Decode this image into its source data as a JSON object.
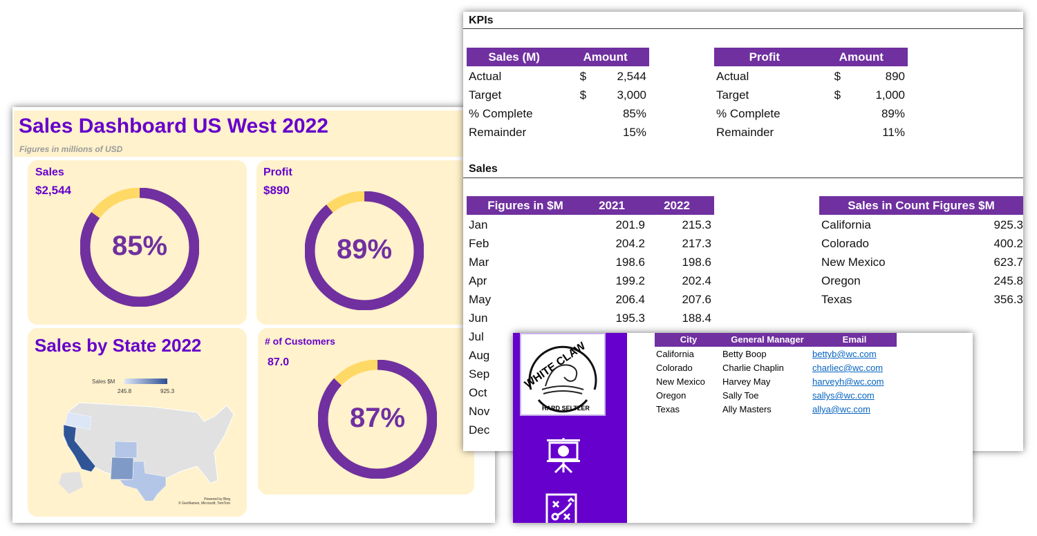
{
  "dashboard": {
    "title": "Sales Dashboard US West 2022",
    "subtitle": "Figures in millions of USD",
    "sales": {
      "label": "Sales",
      "value": "$2,544",
      "percent_label": "85%",
      "fraction": 0.85
    },
    "profit": {
      "label": "Profit",
      "value": "$890",
      "percent_label": "89%",
      "fraction": 0.89
    },
    "customers": {
      "label": "# of Customers",
      "value": "87.0",
      "percent_label": "87%",
      "fraction": 0.87
    },
    "map": {
      "title": "Sales by State 2022",
      "legend_label": "Sales $M",
      "legend_min": "245.8",
      "legend_max": "925.3",
      "credit1": "Powered by Bing",
      "credit2": "© GeoNames, Microsoft, TomTom"
    },
    "colors": {
      "accent": "#6600cc",
      "donut": "#7030a0",
      "donut_rest": "#ffd966",
      "panel": "#fff2cc"
    }
  },
  "kpis": {
    "title": "KPIs",
    "sales_table": {
      "headers": [
        "Sales (M)",
        "Amount"
      ],
      "rows": [
        [
          "Actual",
          "$",
          "2,544"
        ],
        [
          "Target",
          "$",
          "3,000"
        ],
        [
          "% Complete",
          "",
          "85%"
        ],
        [
          "Remainder",
          "",
          "15%"
        ]
      ]
    },
    "profit_table": {
      "headers": [
        "Profit",
        "Amount"
      ],
      "rows": [
        [
          "Actual",
          "$",
          "890"
        ],
        [
          "Target",
          "$",
          "1,000"
        ],
        [
          "% Complete",
          "",
          "89%"
        ],
        [
          "Remainder",
          "",
          "11%"
        ]
      ]
    }
  },
  "sales": {
    "title": "Sales",
    "monthly": {
      "headers": [
        "Figures in $M",
        "2021",
        "2022"
      ],
      "rows": [
        [
          "Jan",
          "201.9",
          "215.3"
        ],
        [
          "Feb",
          "204.2",
          "217.3"
        ],
        [
          "Mar",
          "198.6",
          "198.6"
        ],
        [
          "Apr",
          "199.2",
          "202.4"
        ],
        [
          "May",
          "206.4",
          "207.6"
        ],
        [
          "Jun",
          "195.3",
          "188.4"
        ],
        [
          "Jul",
          "",
          ""
        ],
        [
          "Aug",
          "",
          ""
        ],
        [
          "Sep",
          "",
          ""
        ],
        [
          "Oct",
          "",
          ""
        ],
        [
          "Nov",
          "",
          ""
        ],
        [
          "Dec",
          "",
          ""
        ]
      ]
    },
    "by_state": {
      "header": "Sales in Count Figures $M",
      "rows": [
        [
          "California",
          "925.3"
        ],
        [
          "Colorado",
          "400.2"
        ],
        [
          "New Mexico",
          "623.7"
        ],
        [
          "Oregon",
          "245.8"
        ],
        [
          "Texas",
          "356.3"
        ]
      ]
    }
  },
  "managers": {
    "logo_text": "WHITE CLAW HARD SELTZER",
    "headers": [
      "City",
      "General Manager",
      "Email"
    ],
    "rows": [
      [
        "California",
        "Betty Boop",
        "bettyb@wc.com"
      ],
      [
        "Colorado",
        "Charlie Chaplin",
        "charliec@wc.com"
      ],
      [
        "New Mexico",
        "Harvey May",
        "harveyh@wc.com"
      ],
      [
        "Oregon",
        "Sally Toe",
        "sallys@wc.com"
      ],
      [
        "Texas",
        "Ally Masters",
        "allya@wc.com"
      ]
    ],
    "icons": [
      "presentation-chart-icon",
      "strategy-playbook-icon"
    ]
  }
}
